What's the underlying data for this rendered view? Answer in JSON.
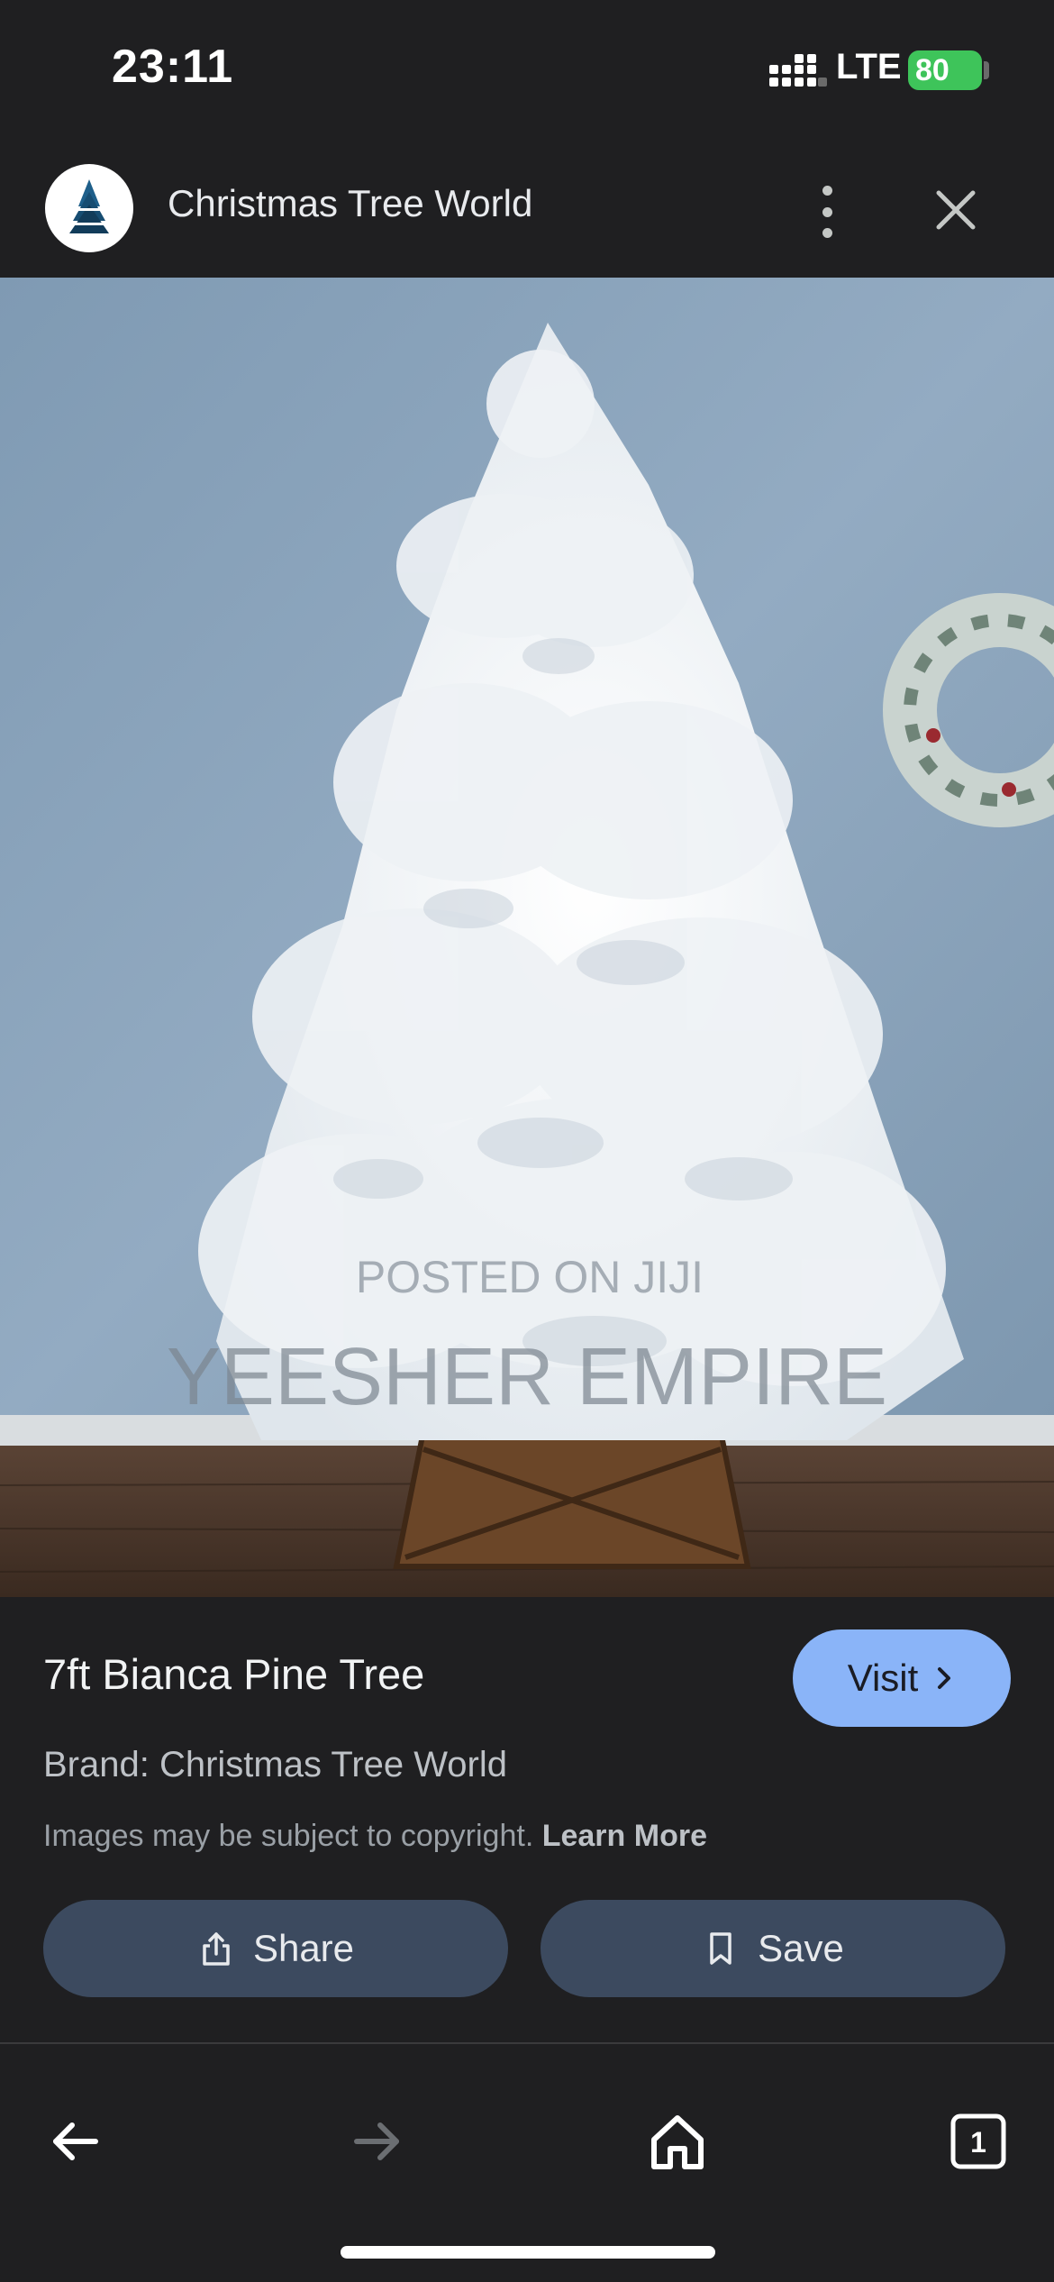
{
  "status_bar": {
    "time": "23:11",
    "network": "LTE",
    "battery_percent": "80"
  },
  "header": {
    "site_name": "Christmas Tree World",
    "logo_icon": "tree-logo-icon",
    "more_icon": "more-vert-icon",
    "close_icon": "close-icon"
  },
  "image": {
    "watermark_small": "POSTED ON JIJI",
    "watermark_large": "YEESHER EMPIRE"
  },
  "product": {
    "title": "7ft Bianca Pine Tree",
    "visit_label": "Visit",
    "brand_line": "Brand: Christmas Tree World",
    "copyright_text": "Images may be subject to copyright.",
    "learn_more": "Learn More",
    "share_label": "Share",
    "save_label": "Save"
  },
  "nav": {
    "back_icon": "arrow-back-icon",
    "forward_icon": "arrow-forward-icon",
    "home_icon": "home-icon",
    "tabs_count": "1"
  },
  "colors": {
    "background": "#1f1f21",
    "accent": "#8ab4f8",
    "button_bg": "#3c4a5f",
    "battery": "#3ec45a"
  }
}
